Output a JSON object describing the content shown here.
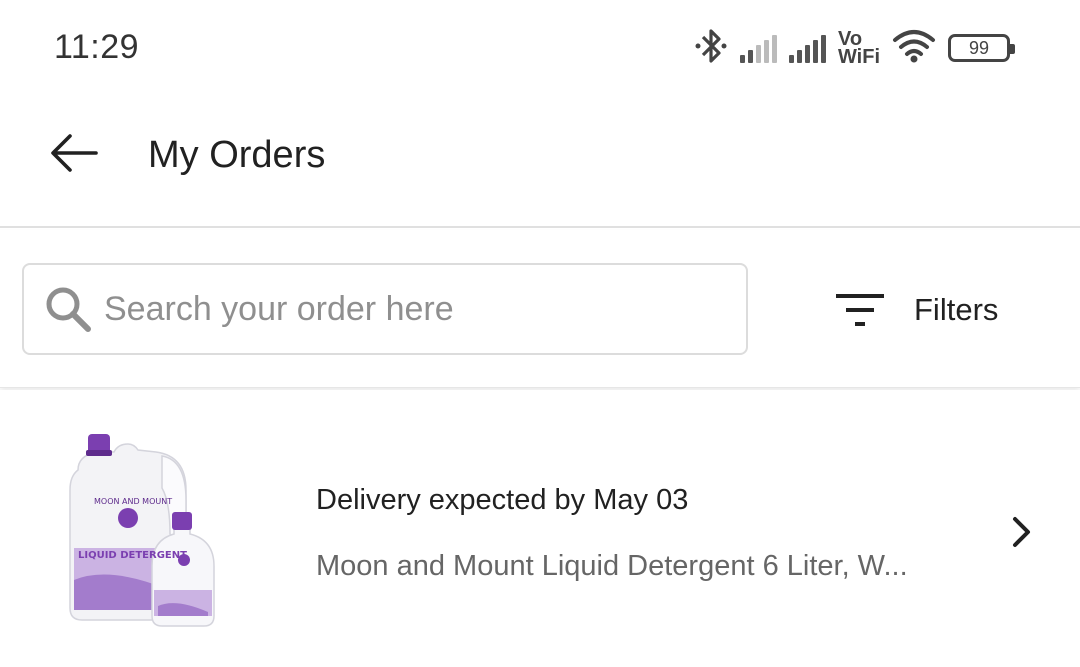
{
  "status_bar": {
    "time": "11:29",
    "battery_level": "99",
    "vowifi_top": "Vo",
    "vowifi_bottom": "WiFi",
    "icons": [
      "bluetooth-icon",
      "signal-icon",
      "signal-icon",
      "vowifi-icon",
      "wifi-icon",
      "battery-icon"
    ]
  },
  "app_bar": {
    "title": "My Orders",
    "back_icon": "arrow-left-icon"
  },
  "search": {
    "placeholder": "Search your order here",
    "icon": "search-icon"
  },
  "filters": {
    "label": "Filters",
    "icon": "filter-icon"
  },
  "orders": [
    {
      "status": "Delivery expected by May 03",
      "title": "Moon and Mount Liquid Detergent 6 Liter, W...",
      "image": "product-image-detergent",
      "chevron": "chevron-right-icon",
      "image_text": {
        "brand": "MOON AND MOUNT",
        "product": "LIQUID DETERGENT"
      }
    }
  ],
  "colors": {
    "accent": "#7b3fb0",
    "text_primary": "#212121",
    "text_secondary": "#666666",
    "placeholder": "#8f8f8f"
  }
}
